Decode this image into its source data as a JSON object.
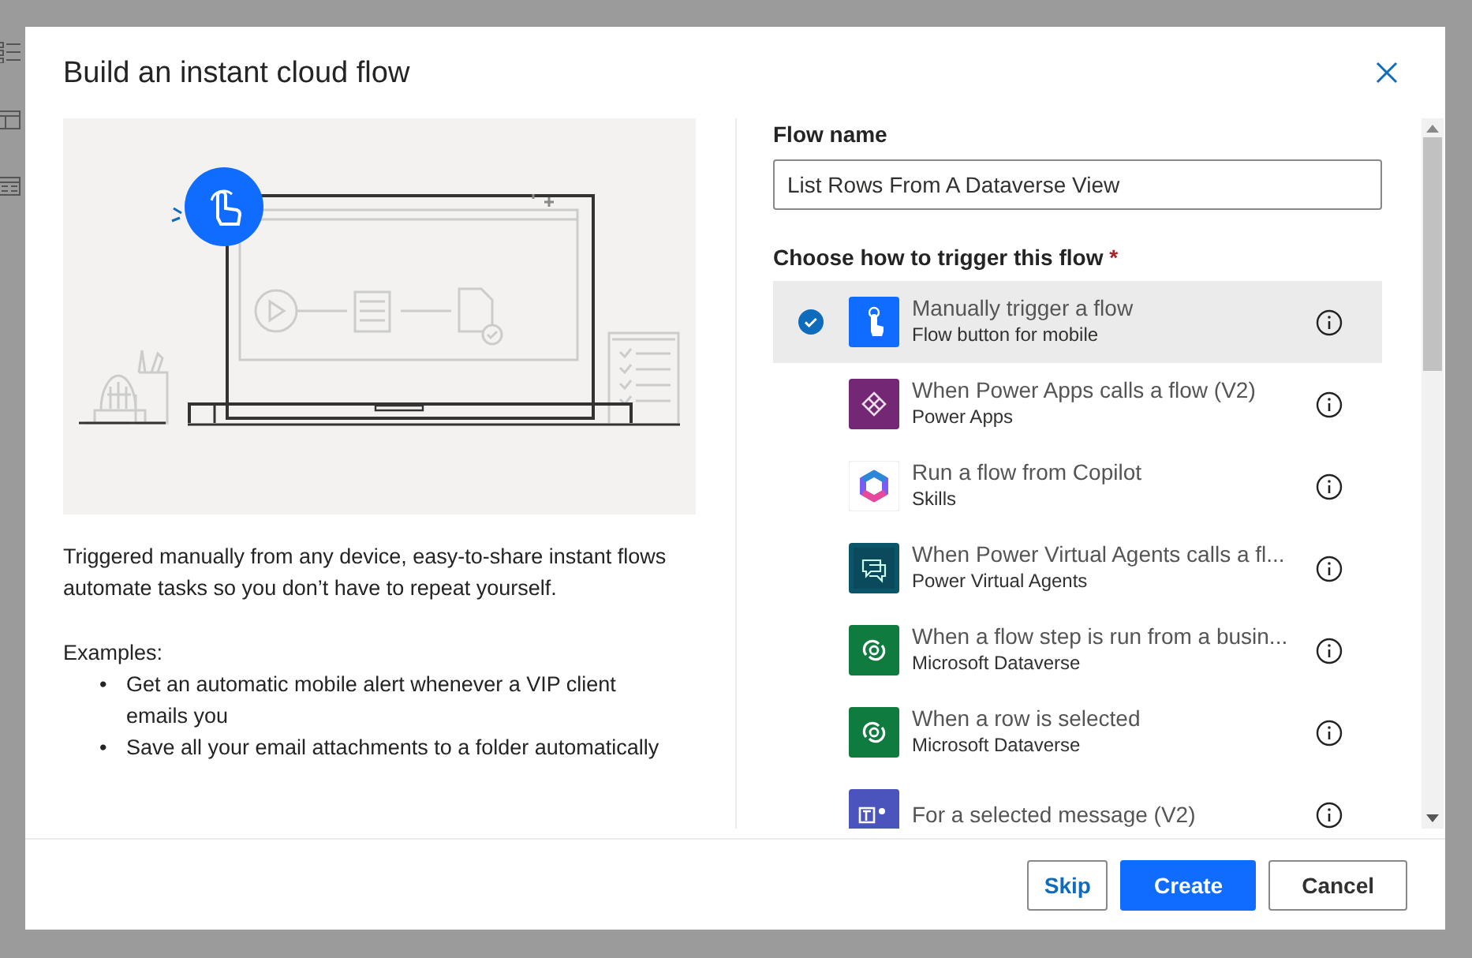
{
  "dialog": {
    "title": "Build an instant cloud flow",
    "description": "Triggered manually from any device, easy-to-share instant flows automate tasks so you don’t have to repeat yourself.",
    "examples_label": "Examples:",
    "examples": [
      {
        "bullet": "•",
        "text": "Get an automatic mobile alert whenever a VIP client emails you"
      },
      {
        "bullet": "•",
        "text": "Save all your email attachments to a folder automatically"
      }
    ],
    "flow_name": {
      "label": "Flow name",
      "value": "List Rows From A Dataverse View"
    },
    "trigger_label": "Choose how to trigger this flow",
    "required_mark": "*",
    "triggers": [
      {
        "kind": "manual",
        "title": "Manually trigger a flow",
        "subtitle": "Flow button for mobile",
        "selected": true
      },
      {
        "kind": "powerapps",
        "title": "When Power Apps calls a flow (V2)",
        "subtitle": "Power Apps",
        "selected": false
      },
      {
        "kind": "copilot",
        "title": "Run a flow from Copilot",
        "subtitle": "Skills",
        "selected": false
      },
      {
        "kind": "agents",
        "title": "When Power Virtual Agents calls a fl...",
        "subtitle": "Power Virtual Agents",
        "selected": false
      },
      {
        "kind": "dataverse",
        "title": "When a flow step is run from a busin...",
        "subtitle": "Microsoft Dataverse",
        "selected": false
      },
      {
        "kind": "dataverse",
        "title": "When a row is selected",
        "subtitle": "Microsoft Dataverse",
        "selected": false
      },
      {
        "kind": "teams",
        "title": "For a selected message (V2)",
        "selected": false
      }
    ],
    "buttons": [
      {
        "kind": "secondary",
        "label": "Skip"
      },
      {
        "kind": "primary",
        "label": "Create"
      },
      {
        "kind": "default",
        "label": "Cancel"
      }
    ]
  }
}
